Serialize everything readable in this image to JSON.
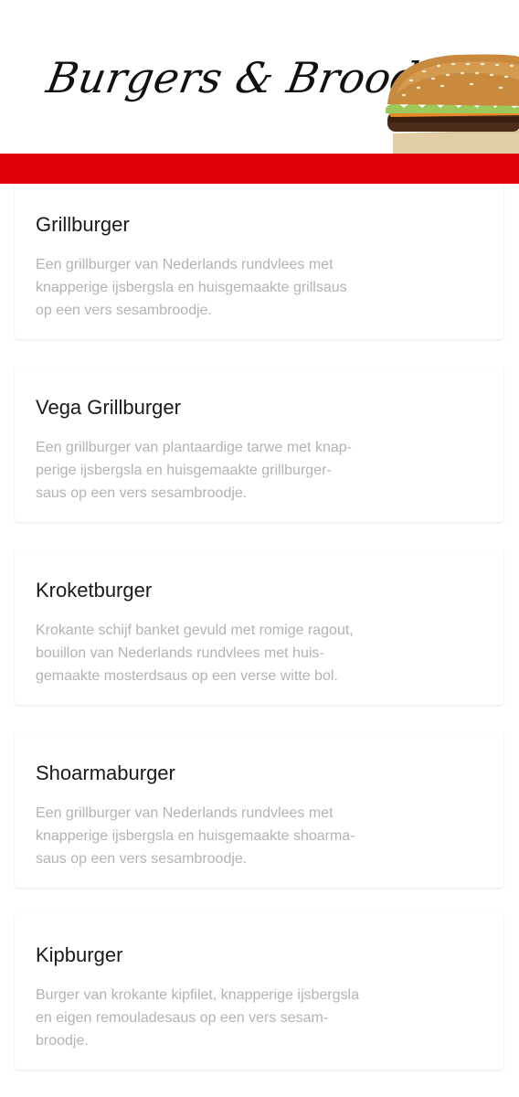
{
  "header": {
    "title": "Burgers & Broodjes",
    "image_icon": "burger-photo",
    "accent_color": "#e3000b"
  },
  "menu": {
    "items": [
      {
        "name": "Grillburger",
        "description_lines": [
          "Een grillburger van Nederlands rundvlees met",
          "knapperige ijsbergsla en huisgemaakte grillsaus",
          "op een vers sesambroodje."
        ]
      },
      {
        "name": "Vega Grillburger",
        "description_lines": [
          "Een grillburger van plantaardige tarwe met knap-",
          "perige ijsbergsla en huisgemaakte grillburger-",
          "saus op een vers sesambroodje."
        ]
      },
      {
        "name": "Kroketburger",
        "description_lines": [
          "Krokante schijf banket gevuld met romige ragout,",
          "bouillon van Nederlands rundvlees met huis-",
          "gemaakte mosterdsaus op een verse witte bol."
        ]
      },
      {
        "name": "Shoarmaburger",
        "description_lines": [
          "Een grillburger van Nederlands rundvlees met",
          "knapperige ijsbergsla en huisgemaakte shoarma-",
          "saus op een vers sesambroodje."
        ]
      },
      {
        "name": "Kipburger",
        "description_lines": [
          "Burger van krokante kipfilet, knapperige ijsbergsla",
          "en eigen remouladesaus op een vers sesam-",
          "broodje."
        ]
      }
    ]
  }
}
